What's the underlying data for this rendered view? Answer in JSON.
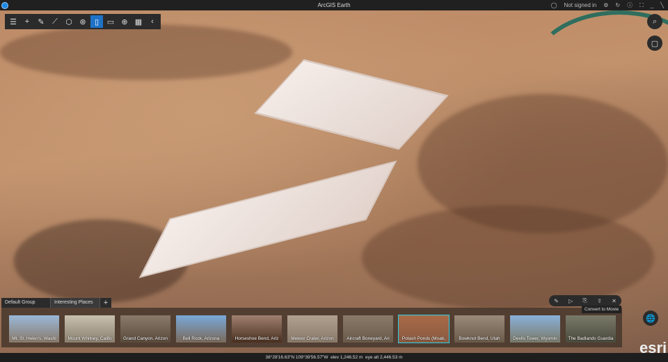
{
  "titlebar": {
    "title": "ArcGIS Earth",
    "user": "Not signed in"
  },
  "toolbar": {
    "items": [
      "layers",
      "add",
      "sketch",
      "measure",
      "analysis",
      "overlay",
      "bookmarks",
      "frame",
      "globe",
      "grid",
      "collapse"
    ],
    "active": "bookmarks"
  },
  "bookmarks": {
    "tabs": [
      "Default Group",
      "Interesting Places"
    ],
    "add_label": "+",
    "items": [
      "Mt. St. Helen's, Washi",
      "Mount Whitney, Califo",
      "Grand Canyon, Arizon",
      "Bell Rock, Arizona",
      "Horseshoe Bend, Ariz",
      "Meteor Crater, Arizon",
      "Aircraft Boneyard, Ari",
      "Potash Ponds (Moab,",
      "Bowknot Bend, Utah",
      "Devils Tower, Wyomin",
      "The Badlands Guardia"
    ],
    "selected_index": 7,
    "tooltip": "Convert to Movie"
  },
  "logo": "esri",
  "status": {
    "coords": "38°28'16.63\"N 109°39'56.57\"W",
    "elev": "elev 1,246.52 m",
    "eye_alt": "eye alt 2,446.53 m"
  },
  "colors": {
    "accent": "#1e72c8",
    "selection": "#2bd0e8"
  }
}
